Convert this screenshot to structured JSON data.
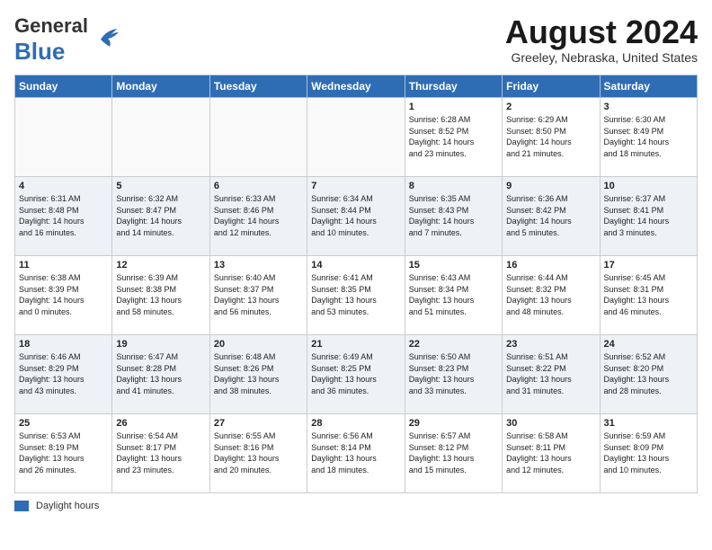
{
  "header": {
    "logo_general": "General",
    "logo_blue": "Blue",
    "month_title": "August 2024",
    "location": "Greeley, Nebraska, United States"
  },
  "legend": {
    "label": "Daylight hours"
  },
  "days_of_week": [
    "Sunday",
    "Monday",
    "Tuesday",
    "Wednesday",
    "Thursday",
    "Friday",
    "Saturday"
  ],
  "weeks": [
    [
      {
        "day": "",
        "info": ""
      },
      {
        "day": "",
        "info": ""
      },
      {
        "day": "",
        "info": ""
      },
      {
        "day": "",
        "info": ""
      },
      {
        "day": "1",
        "info": "Sunrise: 6:28 AM\nSunset: 8:52 PM\nDaylight: 14 hours\nand 23 minutes."
      },
      {
        "day": "2",
        "info": "Sunrise: 6:29 AM\nSunset: 8:50 PM\nDaylight: 14 hours\nand 21 minutes."
      },
      {
        "day": "3",
        "info": "Sunrise: 6:30 AM\nSunset: 8:49 PM\nDaylight: 14 hours\nand 18 minutes."
      }
    ],
    [
      {
        "day": "4",
        "info": "Sunrise: 6:31 AM\nSunset: 8:48 PM\nDaylight: 14 hours\nand 16 minutes."
      },
      {
        "day": "5",
        "info": "Sunrise: 6:32 AM\nSunset: 8:47 PM\nDaylight: 14 hours\nand 14 minutes."
      },
      {
        "day": "6",
        "info": "Sunrise: 6:33 AM\nSunset: 8:46 PM\nDaylight: 14 hours\nand 12 minutes."
      },
      {
        "day": "7",
        "info": "Sunrise: 6:34 AM\nSunset: 8:44 PM\nDaylight: 14 hours\nand 10 minutes."
      },
      {
        "day": "8",
        "info": "Sunrise: 6:35 AM\nSunset: 8:43 PM\nDaylight: 14 hours\nand 7 minutes."
      },
      {
        "day": "9",
        "info": "Sunrise: 6:36 AM\nSunset: 8:42 PM\nDaylight: 14 hours\nand 5 minutes."
      },
      {
        "day": "10",
        "info": "Sunrise: 6:37 AM\nSunset: 8:41 PM\nDaylight: 14 hours\nand 3 minutes."
      }
    ],
    [
      {
        "day": "11",
        "info": "Sunrise: 6:38 AM\nSunset: 8:39 PM\nDaylight: 14 hours\nand 0 minutes."
      },
      {
        "day": "12",
        "info": "Sunrise: 6:39 AM\nSunset: 8:38 PM\nDaylight: 13 hours\nand 58 minutes."
      },
      {
        "day": "13",
        "info": "Sunrise: 6:40 AM\nSunset: 8:37 PM\nDaylight: 13 hours\nand 56 minutes."
      },
      {
        "day": "14",
        "info": "Sunrise: 6:41 AM\nSunset: 8:35 PM\nDaylight: 13 hours\nand 53 minutes."
      },
      {
        "day": "15",
        "info": "Sunrise: 6:43 AM\nSunset: 8:34 PM\nDaylight: 13 hours\nand 51 minutes."
      },
      {
        "day": "16",
        "info": "Sunrise: 6:44 AM\nSunset: 8:32 PM\nDaylight: 13 hours\nand 48 minutes."
      },
      {
        "day": "17",
        "info": "Sunrise: 6:45 AM\nSunset: 8:31 PM\nDaylight: 13 hours\nand 46 minutes."
      }
    ],
    [
      {
        "day": "18",
        "info": "Sunrise: 6:46 AM\nSunset: 8:29 PM\nDaylight: 13 hours\nand 43 minutes."
      },
      {
        "day": "19",
        "info": "Sunrise: 6:47 AM\nSunset: 8:28 PM\nDaylight: 13 hours\nand 41 minutes."
      },
      {
        "day": "20",
        "info": "Sunrise: 6:48 AM\nSunset: 8:26 PM\nDaylight: 13 hours\nand 38 minutes."
      },
      {
        "day": "21",
        "info": "Sunrise: 6:49 AM\nSunset: 8:25 PM\nDaylight: 13 hours\nand 36 minutes."
      },
      {
        "day": "22",
        "info": "Sunrise: 6:50 AM\nSunset: 8:23 PM\nDaylight: 13 hours\nand 33 minutes."
      },
      {
        "day": "23",
        "info": "Sunrise: 6:51 AM\nSunset: 8:22 PM\nDaylight: 13 hours\nand 31 minutes."
      },
      {
        "day": "24",
        "info": "Sunrise: 6:52 AM\nSunset: 8:20 PM\nDaylight: 13 hours\nand 28 minutes."
      }
    ],
    [
      {
        "day": "25",
        "info": "Sunrise: 6:53 AM\nSunset: 8:19 PM\nDaylight: 13 hours\nand 26 minutes."
      },
      {
        "day": "26",
        "info": "Sunrise: 6:54 AM\nSunset: 8:17 PM\nDaylight: 13 hours\nand 23 minutes."
      },
      {
        "day": "27",
        "info": "Sunrise: 6:55 AM\nSunset: 8:16 PM\nDaylight: 13 hours\nand 20 minutes."
      },
      {
        "day": "28",
        "info": "Sunrise: 6:56 AM\nSunset: 8:14 PM\nDaylight: 13 hours\nand 18 minutes."
      },
      {
        "day": "29",
        "info": "Sunrise: 6:57 AM\nSunset: 8:12 PM\nDaylight: 13 hours\nand 15 minutes."
      },
      {
        "day": "30",
        "info": "Sunrise: 6:58 AM\nSunset: 8:11 PM\nDaylight: 13 hours\nand 12 minutes."
      },
      {
        "day": "31",
        "info": "Sunrise: 6:59 AM\nSunset: 8:09 PM\nDaylight: 13 hours\nand 10 minutes."
      }
    ]
  ]
}
